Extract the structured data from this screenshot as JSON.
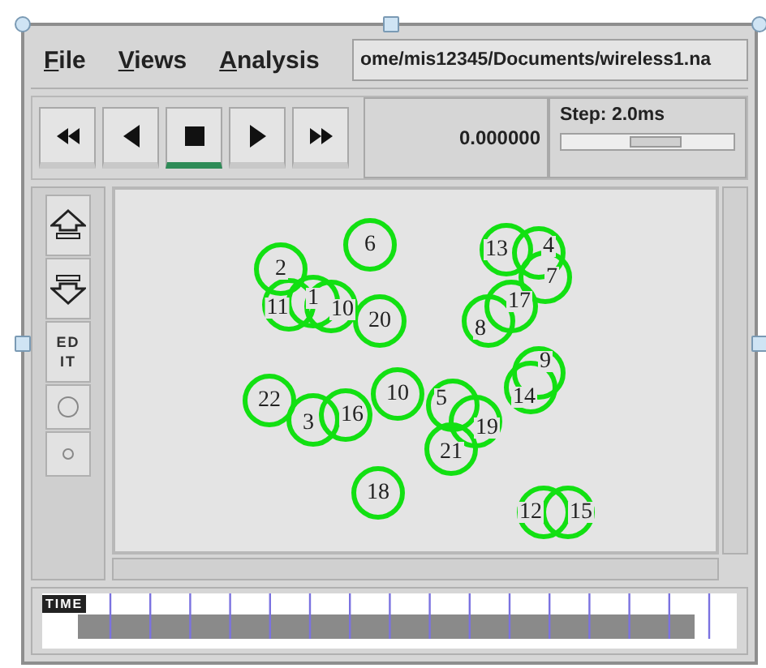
{
  "menu": [
    {
      "label": "File"
    },
    {
      "label": "Views"
    },
    {
      "label": "Analysis"
    }
  ],
  "path_field": {
    "value": "ome/mis12345/Documents/wireless1.na"
  },
  "transport": [
    {
      "kind": "rewind",
      "selected": false
    },
    {
      "kind": "back",
      "selected": false
    },
    {
      "kind": "stop",
      "selected": true
    },
    {
      "kind": "play",
      "selected": false
    },
    {
      "kind": "forward",
      "selected": false
    }
  ],
  "time": "0.000000",
  "step": {
    "label": "Step: 2.0ms",
    "level": 0.55
  },
  "side_tools": [
    {
      "kind": "up"
    },
    {
      "kind": "down"
    },
    {
      "kind": "text",
      "label": "ED IT"
    },
    {
      "kind": "circle-large"
    },
    {
      "kind": "circle-small"
    }
  ],
  "nodes": [
    {
      "label": "6"
    },
    {
      "label": "13"
    },
    {
      "label": "4"
    },
    {
      "label": "2"
    },
    {
      "label": "7"
    },
    {
      "label": "11"
    },
    {
      "label": "1"
    },
    {
      "label": "10"
    },
    {
      "label": "20"
    },
    {
      "label": "8"
    },
    {
      "label": "17"
    },
    {
      "label": "9"
    },
    {
      "label": "22"
    },
    {
      "label": "3"
    },
    {
      "label": "16"
    },
    {
      "label": "10"
    },
    {
      "label": "5"
    },
    {
      "label": "19"
    },
    {
      "label": "14"
    },
    {
      "label": "21"
    },
    {
      "label": "18"
    },
    {
      "label": "12"
    },
    {
      "label": "15"
    }
  ],
  "timeline": {
    "label": "TIME"
  }
}
